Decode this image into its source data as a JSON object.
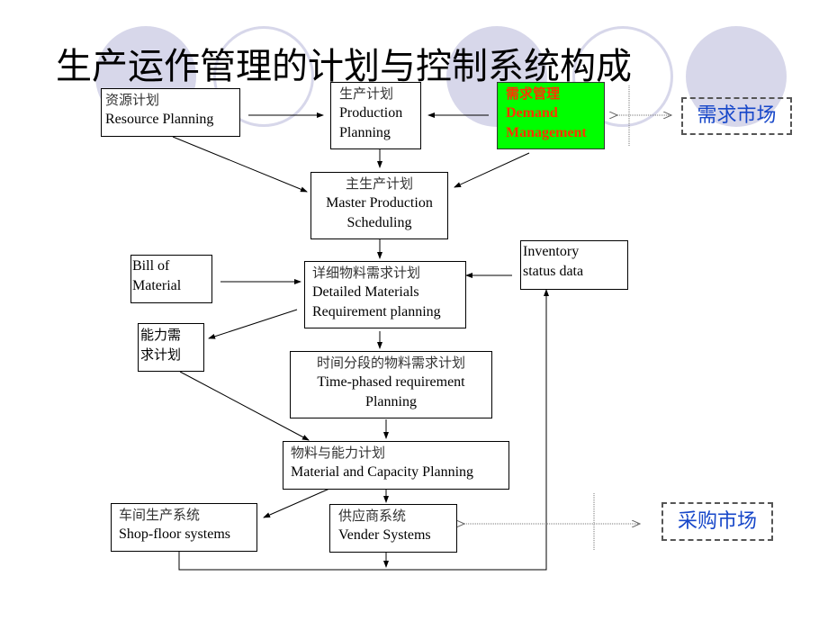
{
  "title": "生产运作管理的计划与控制系统构成",
  "nodes": {
    "resource_planning": {
      "zh": "资源计划",
      "en": "Resource Planning"
    },
    "production_planning": {
      "zh": "生产计划",
      "en1": "Production",
      "en2": "Planning"
    },
    "demand_management": {
      "zh": "需求管理",
      "en1": "Demand",
      "en2": "Management"
    },
    "demand_market": "需求市场",
    "master_production": {
      "zh": "主生产计划",
      "en1": "Master Production",
      "en2": "Scheduling"
    },
    "bill_of_material": {
      "en1": "Bill of",
      "en2": "Material"
    },
    "detailed_mrp": {
      "zh": "详细物料需求计划",
      "en1": "Detailed Materials",
      "en2": "Requirement planning"
    },
    "inventory_status": {
      "en1": "Inventory",
      "en2": "status data"
    },
    "capacity_requirement": {
      "zh1": "能力需",
      "zh2": "求计划"
    },
    "time_phased": {
      "zh": "时间分段的物料需求计划",
      "en1": "Time-phased requirement",
      "en2": "Planning"
    },
    "material_capacity": {
      "zh": "物料与能力计划",
      "en": "Material and Capacity Planning"
    },
    "shop_floor": {
      "zh": "车间生产系统",
      "en": "Shop-floor systems"
    },
    "vender_systems": {
      "zh": "供应商系统",
      "en": "Vender Systems"
    },
    "purchase_market": "采购市场"
  },
  "colors": {
    "demand_fill": "#00ff00",
    "demand_text": "#ff3300",
    "market_text": "#1747c9",
    "decor_circle": "#d7d7ea"
  }
}
